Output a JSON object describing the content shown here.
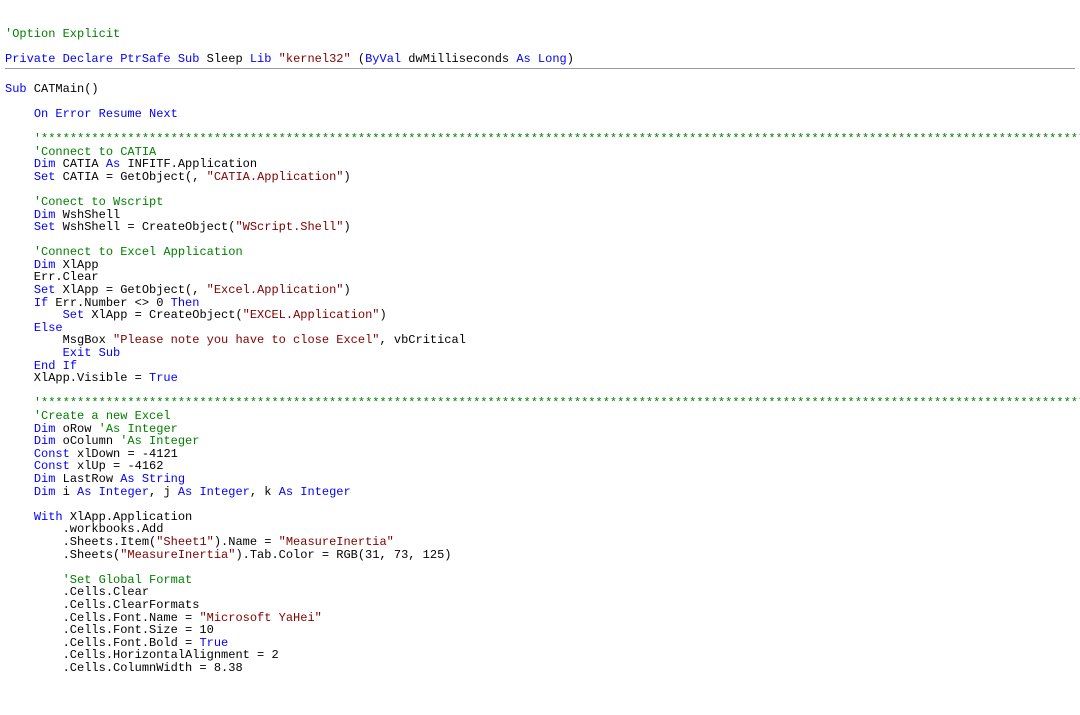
{
  "tokens": [
    {
      "t": "'Option Explicit",
      "cls": "comment"
    },
    {
      "t": "\n"
    },
    {
      "t": "\n"
    },
    {
      "t": "Private Declare ",
      "cls": "keyword"
    },
    {
      "t": "PtrSafe ",
      "cls": "keyword"
    },
    {
      "t": "Sub",
      "cls": "keyword"
    },
    {
      "t": " Sleep ",
      "cls": "text"
    },
    {
      "t": "Lib",
      "cls": "keyword"
    },
    {
      "t": " ",
      "cls": "text"
    },
    {
      "t": "\"kernel32\"",
      "cls": "string"
    },
    {
      "t": " (",
      "cls": "text"
    },
    {
      "t": "ByVal",
      "cls": "keyword"
    },
    {
      "t": " dwMilliseconds ",
      "cls": "text"
    },
    {
      "t": "As Long",
      "cls": "keyword"
    },
    {
      "t": ")",
      "cls": "text"
    },
    {
      "t": "\n"
    },
    {
      "t": "---HR---"
    },
    {
      "t": "\n"
    },
    {
      "t": "Sub",
      "cls": "keyword"
    },
    {
      "t": " CATMain()",
      "cls": "text"
    },
    {
      "t": "\n"
    },
    {
      "t": "\n"
    },
    {
      "t": "    ",
      "cls": "text"
    },
    {
      "t": "On Error Resume Next",
      "cls": "keyword"
    },
    {
      "t": "\n"
    },
    {
      "t": "\n"
    },
    {
      "t": "    ",
      "cls": "text"
    },
    {
      "t": "'**************************************************************************************************************************************************************************",
      "cls": "comment"
    },
    {
      "t": "\n"
    },
    {
      "t": "    ",
      "cls": "text"
    },
    {
      "t": "'Connect to CATIA",
      "cls": "comment"
    },
    {
      "t": "\n"
    },
    {
      "t": "    ",
      "cls": "text"
    },
    {
      "t": "Dim",
      "cls": "keyword"
    },
    {
      "t": " CATIA ",
      "cls": "text"
    },
    {
      "t": "As",
      "cls": "keyword"
    },
    {
      "t": " INFITF.Application",
      "cls": "text"
    },
    {
      "t": "\n"
    },
    {
      "t": "    ",
      "cls": "text"
    },
    {
      "t": "Set",
      "cls": "keyword"
    },
    {
      "t": " CATIA = GetObject(, ",
      "cls": "text"
    },
    {
      "t": "\"CATIA.Application\"",
      "cls": "string"
    },
    {
      "t": ")",
      "cls": "text"
    },
    {
      "t": "\n"
    },
    {
      "t": "\n"
    },
    {
      "t": "    ",
      "cls": "text"
    },
    {
      "t": "'Conect to Wscript",
      "cls": "comment"
    },
    {
      "t": "\n"
    },
    {
      "t": "    ",
      "cls": "text"
    },
    {
      "t": "Dim",
      "cls": "keyword"
    },
    {
      "t": " WshShell",
      "cls": "text"
    },
    {
      "t": "\n"
    },
    {
      "t": "    ",
      "cls": "text"
    },
    {
      "t": "Set",
      "cls": "keyword"
    },
    {
      "t": " WshShell = CreateObject(",
      "cls": "text"
    },
    {
      "t": "\"WScript.Shell\"",
      "cls": "string"
    },
    {
      "t": ")",
      "cls": "text"
    },
    {
      "t": "\n"
    },
    {
      "t": "\n"
    },
    {
      "t": "    ",
      "cls": "text"
    },
    {
      "t": "'Connect to Excel Application",
      "cls": "comment"
    },
    {
      "t": "\n"
    },
    {
      "t": "    ",
      "cls": "text"
    },
    {
      "t": "Dim",
      "cls": "keyword"
    },
    {
      "t": " XlApp",
      "cls": "text"
    },
    {
      "t": "\n"
    },
    {
      "t": "    Err.Clear",
      "cls": "text"
    },
    {
      "t": "\n"
    },
    {
      "t": "    ",
      "cls": "text"
    },
    {
      "t": "Set",
      "cls": "keyword"
    },
    {
      "t": " XlApp = GetObject(, ",
      "cls": "text"
    },
    {
      "t": "\"Excel.Application\"",
      "cls": "string"
    },
    {
      "t": ")",
      "cls": "text"
    },
    {
      "t": "\n"
    },
    {
      "t": "    ",
      "cls": "text"
    },
    {
      "t": "If",
      "cls": "keyword"
    },
    {
      "t": " Err.Number <> 0 ",
      "cls": "text"
    },
    {
      "t": "Then",
      "cls": "keyword"
    },
    {
      "t": "\n"
    },
    {
      "t": "        ",
      "cls": "text"
    },
    {
      "t": "Set",
      "cls": "keyword"
    },
    {
      "t": " XlApp = CreateObject(",
      "cls": "text"
    },
    {
      "t": "\"EXCEL.Application\"",
      "cls": "string"
    },
    {
      "t": ")",
      "cls": "text"
    },
    {
      "t": "\n"
    },
    {
      "t": "    ",
      "cls": "text"
    },
    {
      "t": "Else",
      "cls": "keyword"
    },
    {
      "t": "\n"
    },
    {
      "t": "        MsgBox ",
      "cls": "text"
    },
    {
      "t": "\"Please note you have to close Excel\"",
      "cls": "string"
    },
    {
      "t": ", vbCritical",
      "cls": "text"
    },
    {
      "t": "\n"
    },
    {
      "t": "        ",
      "cls": "text"
    },
    {
      "t": "Exit Sub",
      "cls": "keyword"
    },
    {
      "t": "\n"
    },
    {
      "t": "    ",
      "cls": "text"
    },
    {
      "t": "End If",
      "cls": "keyword"
    },
    {
      "t": "\n"
    },
    {
      "t": "    XlApp.Visible = ",
      "cls": "text"
    },
    {
      "t": "True",
      "cls": "keyword"
    },
    {
      "t": "\n"
    },
    {
      "t": "\n"
    },
    {
      "t": "    ",
      "cls": "text"
    },
    {
      "t": "'**************************************************************************************************************************************************************************",
      "cls": "comment"
    },
    {
      "t": "\n"
    },
    {
      "t": "    ",
      "cls": "text"
    },
    {
      "t": "'Create a new Excel",
      "cls": "comment"
    },
    {
      "t": "\n"
    },
    {
      "t": "    ",
      "cls": "text"
    },
    {
      "t": "Dim",
      "cls": "keyword"
    },
    {
      "t": " oRow ",
      "cls": "text"
    },
    {
      "t": "'As Integer",
      "cls": "comment"
    },
    {
      "t": "\n"
    },
    {
      "t": "    ",
      "cls": "text"
    },
    {
      "t": "Dim",
      "cls": "keyword"
    },
    {
      "t": " oColumn ",
      "cls": "text"
    },
    {
      "t": "'As Integer",
      "cls": "comment"
    },
    {
      "t": "\n"
    },
    {
      "t": "    ",
      "cls": "text"
    },
    {
      "t": "Const",
      "cls": "keyword"
    },
    {
      "t": " xlDown = -4121",
      "cls": "text"
    },
    {
      "t": "\n"
    },
    {
      "t": "    ",
      "cls": "text"
    },
    {
      "t": "Const",
      "cls": "keyword"
    },
    {
      "t": " xlUp = -4162",
      "cls": "text"
    },
    {
      "t": "\n"
    },
    {
      "t": "    ",
      "cls": "text"
    },
    {
      "t": "Dim",
      "cls": "keyword"
    },
    {
      "t": " LastRow ",
      "cls": "text"
    },
    {
      "t": "As String",
      "cls": "keyword"
    },
    {
      "t": "\n"
    },
    {
      "t": "    ",
      "cls": "text"
    },
    {
      "t": "Dim",
      "cls": "keyword"
    },
    {
      "t": " i ",
      "cls": "text"
    },
    {
      "t": "As Integer",
      "cls": "keyword"
    },
    {
      "t": ", j ",
      "cls": "text"
    },
    {
      "t": "As Integer",
      "cls": "keyword"
    },
    {
      "t": ", k ",
      "cls": "text"
    },
    {
      "t": "As Integer",
      "cls": "keyword"
    },
    {
      "t": "\n"
    },
    {
      "t": "\n"
    },
    {
      "t": "    ",
      "cls": "text"
    },
    {
      "t": "With",
      "cls": "keyword"
    },
    {
      "t": " XlApp.Application",
      "cls": "text"
    },
    {
      "t": "\n"
    },
    {
      "t": "        .workbooks.Add",
      "cls": "text"
    },
    {
      "t": "\n"
    },
    {
      "t": "        .Sheets.Item(",
      "cls": "text"
    },
    {
      "t": "\"Sheet1\"",
      "cls": "string"
    },
    {
      "t": ").Name = ",
      "cls": "text"
    },
    {
      "t": "\"MeasureInertia\"",
      "cls": "string"
    },
    {
      "t": "\n"
    },
    {
      "t": "        .Sheets(",
      "cls": "text"
    },
    {
      "t": "\"MeasureInertia\"",
      "cls": "string"
    },
    {
      "t": ").Tab.Color = RGB(31, 73, 125)",
      "cls": "text"
    },
    {
      "t": "\n"
    },
    {
      "t": "\n"
    },
    {
      "t": "        ",
      "cls": "text"
    },
    {
      "t": "'Set Global Format",
      "cls": "comment"
    },
    {
      "t": "\n"
    },
    {
      "t": "        .Cells.Clear",
      "cls": "text"
    },
    {
      "t": "\n"
    },
    {
      "t": "        .Cells.ClearFormats",
      "cls": "text"
    },
    {
      "t": "\n"
    },
    {
      "t": "        .Cells.Font.Name = ",
      "cls": "text"
    },
    {
      "t": "\"Microsoft YaHei\"",
      "cls": "string"
    },
    {
      "t": "\n"
    },
    {
      "t": "        .Cells.Font.Size = 10",
      "cls": "text"
    },
    {
      "t": "\n"
    },
    {
      "t": "        .Cells.Font.Bold = ",
      "cls": "text"
    },
    {
      "t": "True",
      "cls": "keyword"
    },
    {
      "t": "\n"
    },
    {
      "t": "        .Cells.HorizontalAlignment = 2",
      "cls": "text"
    },
    {
      "t": "\n"
    },
    {
      "t": "        .Cells.ColumnWidth = 8.38",
      "cls": "text"
    },
    {
      "t": "\n"
    }
  ]
}
